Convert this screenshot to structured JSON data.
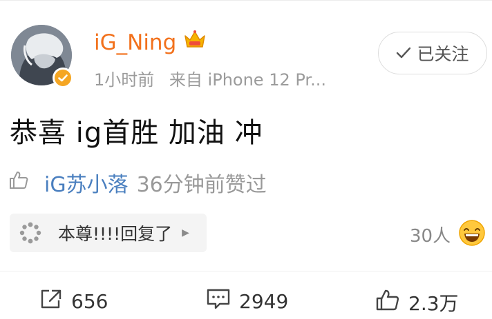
{
  "post": {
    "author": {
      "name": "iG_Ning",
      "badge_icon": "crown-badge-icon",
      "verified_icon": "verified-badge-icon"
    },
    "meta": {
      "time": "1小时前",
      "source": "来自 iPhone 12 Pr..."
    },
    "follow_button": {
      "label": "已关注",
      "icon": "check-icon"
    },
    "text": "恭喜 ig首胜  加油 冲",
    "liked_by": {
      "icon": "thumbs-up-outline-icon",
      "user": "iG苏小落",
      "text": "36分钟前赞过"
    },
    "reply_chip": {
      "icon": "spinner-dots-icon",
      "text": "本尊!!!!回复了",
      "arrow_icon": "triangle-right-icon"
    },
    "reaction_count": "30人",
    "reaction_emoji": "laughing-emoji-icon",
    "actions": {
      "share": {
        "icon": "share-icon",
        "count": "656"
      },
      "comment": {
        "icon": "comment-icon",
        "count": "2949"
      },
      "like": {
        "icon": "thumbs-up-icon",
        "count": "2.3万"
      }
    }
  },
  "colors": {
    "username": "#f2711c",
    "link": "#4a7fbf",
    "muted": "#9b9b9b",
    "verified": "#f5a623"
  }
}
